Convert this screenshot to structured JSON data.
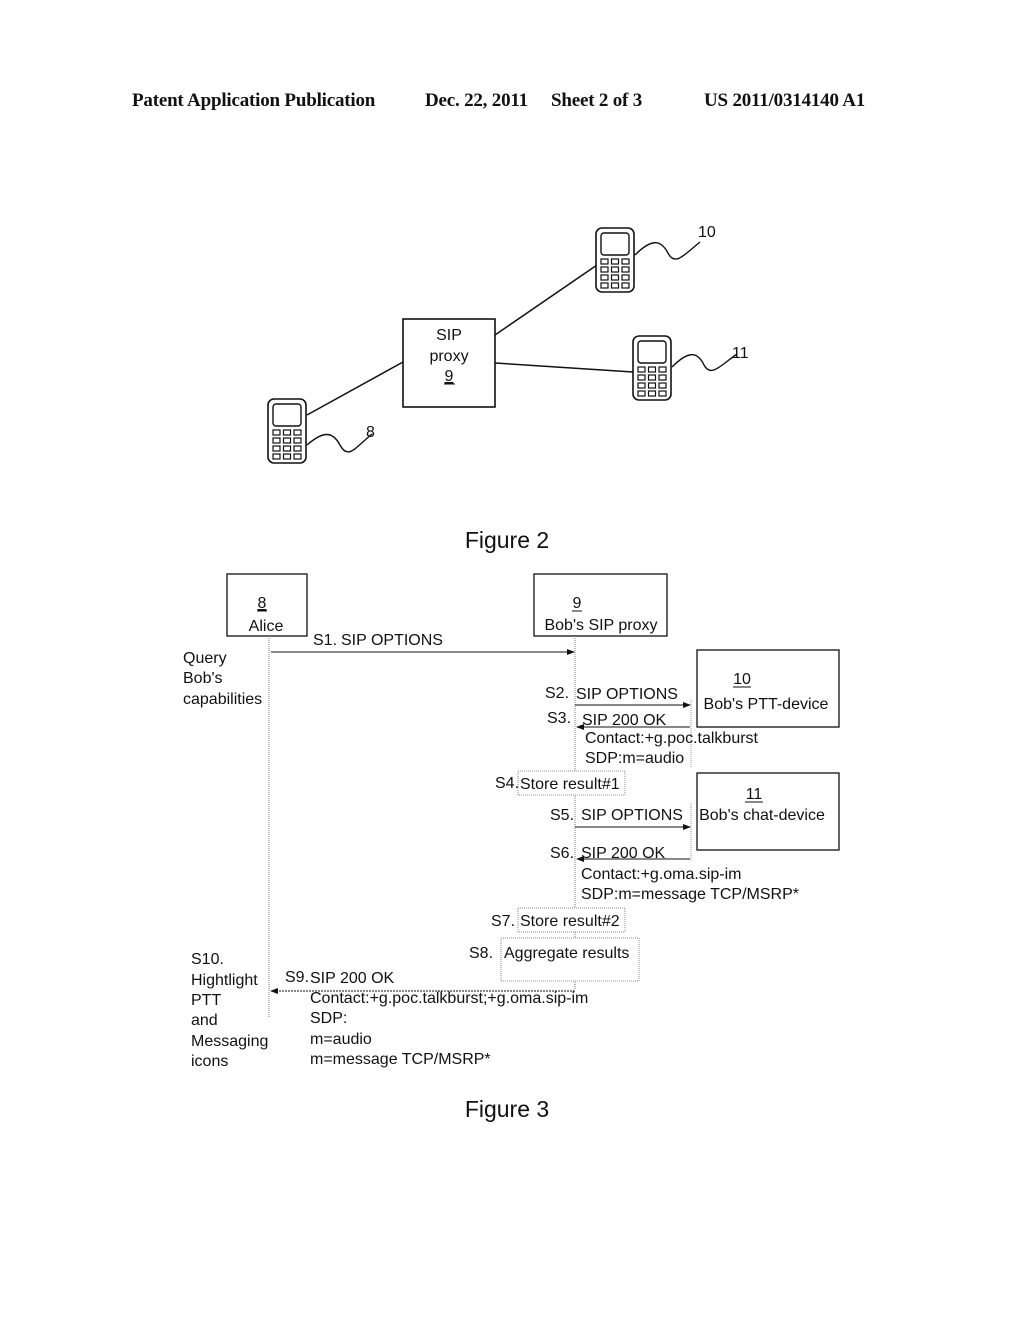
{
  "header": {
    "publication": "Patent Application Publication",
    "date": "Dec. 22, 2011",
    "sheet": "Sheet 2 of 3",
    "pub_number": "US 2011/0314140 A1"
  },
  "figure2": {
    "caption": "Figure 2",
    "proxy": {
      "line1": "SIP",
      "line2": "proxy",
      "ref": "9"
    },
    "devices": [
      {
        "ref": "8"
      },
      {
        "ref": "10"
      },
      {
        "ref": "11"
      }
    ]
  },
  "figure3": {
    "caption": "Figure 3",
    "actors": {
      "alice": {
        "ref": "8",
        "name": "Alice"
      },
      "proxy": {
        "ref": "9",
        "name": "Bob's SIP proxy"
      },
      "ptt": {
        "ref": "10",
        "name": "Bob's PTT-device"
      },
      "chat": {
        "ref": "11",
        "name": "Bob's chat-device"
      }
    },
    "query_note": [
      "Query",
      "Bob's",
      "capabilities"
    ],
    "steps": {
      "s1": {
        "id": "S1.",
        "label": "SIP OPTIONS"
      },
      "s2": {
        "id": "S2.",
        "label": "SIP OPTIONS"
      },
      "s3": {
        "id": "S3.",
        "label": "SIP 200 OK",
        "contact": "Contact:+g.poc.talkburst",
        "sdp": "SDP:m=audio"
      },
      "s4": {
        "id": "S4.",
        "label": "Store result#1"
      },
      "s5": {
        "id": "S5.",
        "label": "SIP OPTIONS"
      },
      "s6": {
        "id": "S6.",
        "label": "SIP 200 OK",
        "contact": "Contact:+g.oma.sip-im",
        "sdp": "SDP:m=message TCP/MSRP*"
      },
      "s7": {
        "id": "S7.",
        "label": "Store result#2"
      },
      "s8": {
        "id": "S8.",
        "label": "Aggregate results"
      },
      "s9": {
        "id": "S9.",
        "label": "SIP 200 OK",
        "contact": "Contact:+g.poc.talkburst;+g.oma.sip-im",
        "sdp": "SDP:",
        "m1": "m=audio",
        "m2": "m=message TCP/MSRP*"
      },
      "s10": {
        "lines": [
          "S10.",
          "Hightlight",
          "PTT",
          "and",
          "Messaging",
          "icons"
        ]
      }
    }
  }
}
